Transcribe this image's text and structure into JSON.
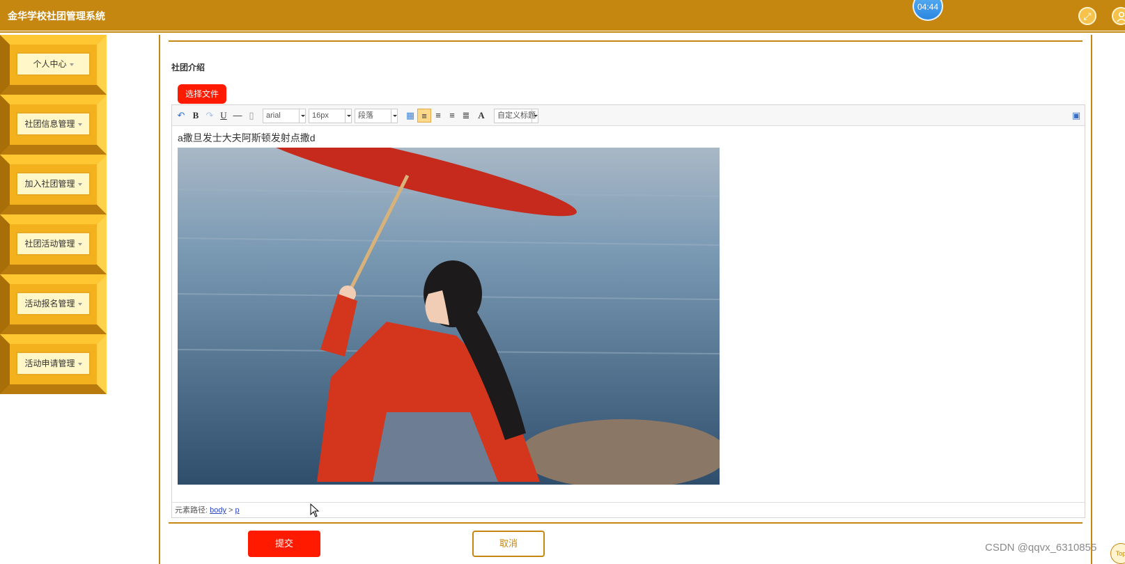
{
  "app": {
    "title": "金华学校社团管理系统",
    "clock": "04:44"
  },
  "sidebar": {
    "items": [
      {
        "label": "个人中心"
      },
      {
        "label": "社团信息管理"
      },
      {
        "label": "加入社团管理"
      },
      {
        "label": "社团活动管理"
      },
      {
        "label": "活动报名管理"
      },
      {
        "label": "活动申请管理"
      }
    ]
  },
  "form": {
    "section_label": "社团介绍",
    "file_button": "选择文件",
    "submit": "提交",
    "cancel": "取消"
  },
  "editor": {
    "toolbar": {
      "font_family": "arial",
      "font_size": "16px",
      "paragraph": "段落",
      "custom_heading": "自定义标题"
    },
    "content_text": "a撒旦发士大夫阿斯顿发射点撒d",
    "status": {
      "path_label": "元素路径:",
      "path_body": "body",
      "path_sep": ">",
      "path_p": "p"
    }
  },
  "watermark": "CSDN @qqvx_6310855",
  "top_button": "Top",
  "colors": {
    "primary": "#c68711",
    "accent_red": "#ff1a00",
    "sidebar_chip": "#fff7c8"
  }
}
